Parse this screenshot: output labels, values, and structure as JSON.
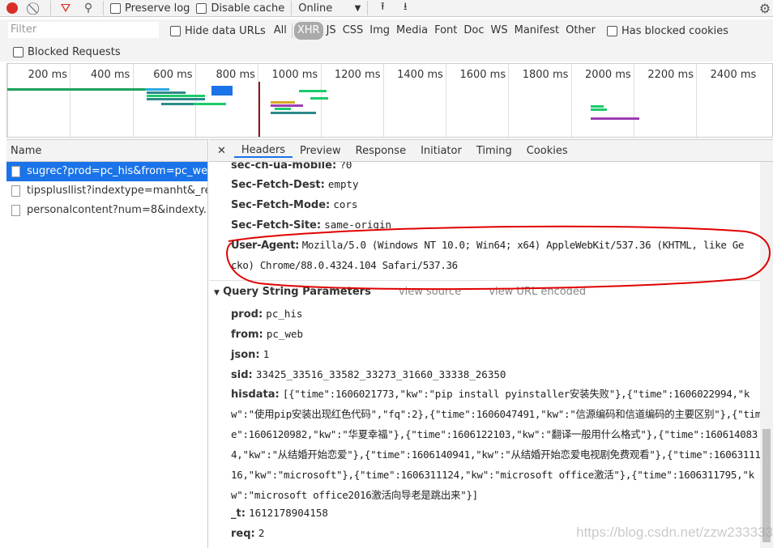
{
  "toolbar": {
    "preserve_log": "Preserve log",
    "disable_cache": "Disable cache",
    "throttle": "Online"
  },
  "filter": {
    "placeholder": "Filter",
    "hide_data_urls": "Hide data URLs",
    "types": [
      "All",
      "XHR",
      "JS",
      "CSS",
      "Img",
      "Media",
      "Font",
      "Doc",
      "WS",
      "Manifest",
      "Other"
    ],
    "active_type": "XHR",
    "has_blocked_cookies": "Has blocked cookies",
    "blocked_requests": "Blocked Requests"
  },
  "timeline": {
    "ticks": [
      "200 ms",
      "400 ms",
      "600 ms",
      "800 ms",
      "1000 ms",
      "1200 ms",
      "1400 ms",
      "1600 ms",
      "1800 ms",
      "2000 ms",
      "2200 ms",
      "2400 ms"
    ]
  },
  "requests": {
    "header": "Name",
    "items": [
      "sugrec?prod=pc_his&from=pc_we...",
      "tipsplusllist?indextype=manht&_re...",
      "personalcontent?num=8&indexty..."
    ],
    "selected": 0
  },
  "detail_tabs": [
    "Headers",
    "Preview",
    "Response",
    "Initiator",
    "Timing",
    "Cookies"
  ],
  "headers": [
    {
      "k": "sec-ch-ua-mobile:",
      "v": "?0"
    },
    {
      "k": "Sec-Fetch-Dest:",
      "v": "empty"
    },
    {
      "k": "Sec-Fetch-Mode:",
      "v": "cors"
    },
    {
      "k": "Sec-Fetch-Site:",
      "v": "same-origin"
    },
    {
      "k": "User-Agent:",
      "v": "Mozilla/5.0 (Windows NT 10.0; Win64; x64) AppleWebKit/537.36 (KHTML, like Ge",
      "v2": "cko) Chrome/88.0.4324.104 Safari/537.36"
    }
  ],
  "query": {
    "title": "Query String Parameters",
    "view_source": "view source",
    "view_url_encoded": "view URL encoded",
    "params": [
      {
        "k": "prod:",
        "v": "pc_his"
      },
      {
        "k": "from:",
        "v": "pc_web"
      },
      {
        "k": "json:",
        "v": "1"
      },
      {
        "k": "sid:",
        "v": "33425_33516_33582_33273_31660_33338_26350"
      },
      {
        "k": "hisdata:",
        "v": "[{\"time\":1606021773,\"kw\":\"pip install pyinstaller安装失败\"},{\"time\":1606022994,\"kw\":\"使用pip安装出现红色代码\",\"fq\":2},{\"time\":1606047491,\"kw\":\"信源编码和信道编码的主要区别\"},{\"time\":1606120982,\"kw\":\"华夏幸福\"},{\"time\":1606122103,\"kw\":\"翻译一般用什么格式\"},{\"time\":1606140834,\"kw\":\"从结婚开始恋爱\"},{\"time\":1606140941,\"kw\":\"从结婚开始恋爱电视剧免费观看\"},{\"time\":1606311116,\"kw\":\"microsoft\"},{\"time\":1606311124,\"kw\":\"microsoft office激活\"},{\"time\":1606311795,\"kw\":\"microsoft office2016激活向导老是跳出来\"}]"
      },
      {
        "k": "_t:",
        "v": "1612178904158"
      },
      {
        "k": "req:",
        "v": "2"
      }
    ]
  },
  "watermark": "https://blog.csdn.net/zzw233333",
  "colors": {
    "record": "#d93025",
    "filter_icon": "#d93025",
    "selected_row": "#1a73e8",
    "annotation": "#e00000"
  }
}
